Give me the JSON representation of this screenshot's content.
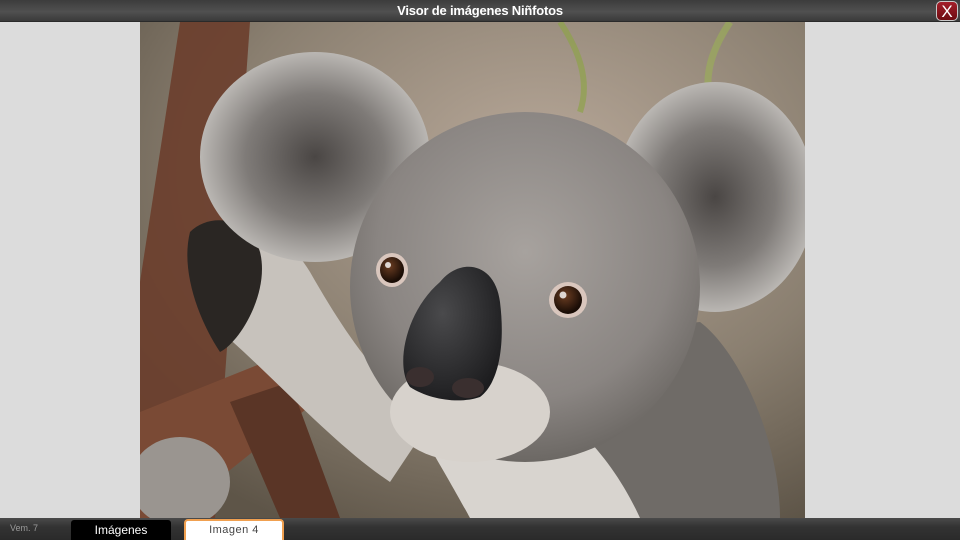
{
  "window": {
    "title": "Visor de imágenes Niñfotos",
    "close_label": "X"
  },
  "viewer": {
    "image_subject": "koala"
  },
  "footer": {
    "version": "Vem. 7",
    "images_tab": "Imágenes",
    "current_image": "Imagen 4"
  },
  "colors": {
    "close_button": "#8b141c",
    "active_tab_border": "#f0a050",
    "bar": "#3c3c3c"
  }
}
